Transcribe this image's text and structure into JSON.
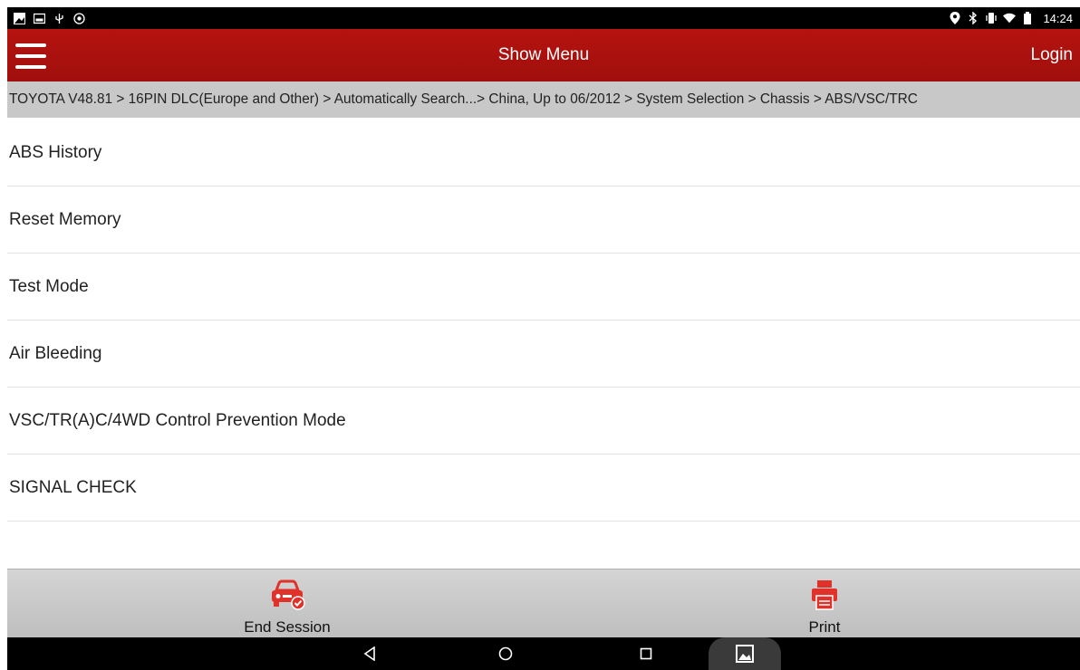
{
  "status_bar": {
    "time": "14:24",
    "left_icons": [
      "image-icon",
      "gallery-icon",
      "usb-debug-icon",
      "shield-icon"
    ],
    "right_icons": [
      "location-icon",
      "bluetooth-icon",
      "vibrate-icon",
      "wifi-icon",
      "battery-icon"
    ]
  },
  "app_bar": {
    "title": "Show Menu",
    "login_label": "Login",
    "color": "#a8110d"
  },
  "breadcrumb": {
    "text": "TOYOTA V48.81 > 16PIN DLC(Europe and Other) > Automatically Search...> China, Up to 06/2012 > System Selection > Chassis > ABS/VSC/TRC"
  },
  "menu": {
    "items": [
      {
        "label": "ABS History"
      },
      {
        "label": "Reset Memory"
      },
      {
        "label": "Test Mode"
      },
      {
        "label": "Air Bleeding"
      },
      {
        "label": "VSC/TR(A)C/4WD Control Prevention Mode"
      },
      {
        "label": "SIGNAL CHECK"
      }
    ]
  },
  "toolbar": {
    "end_session_label": "End Session",
    "print_label": "Print",
    "icon_color": "#e0312b"
  },
  "nav_bar": {
    "buttons": [
      "back-icon",
      "home-icon",
      "recent-apps-icon",
      "screenshot-icon"
    ]
  }
}
